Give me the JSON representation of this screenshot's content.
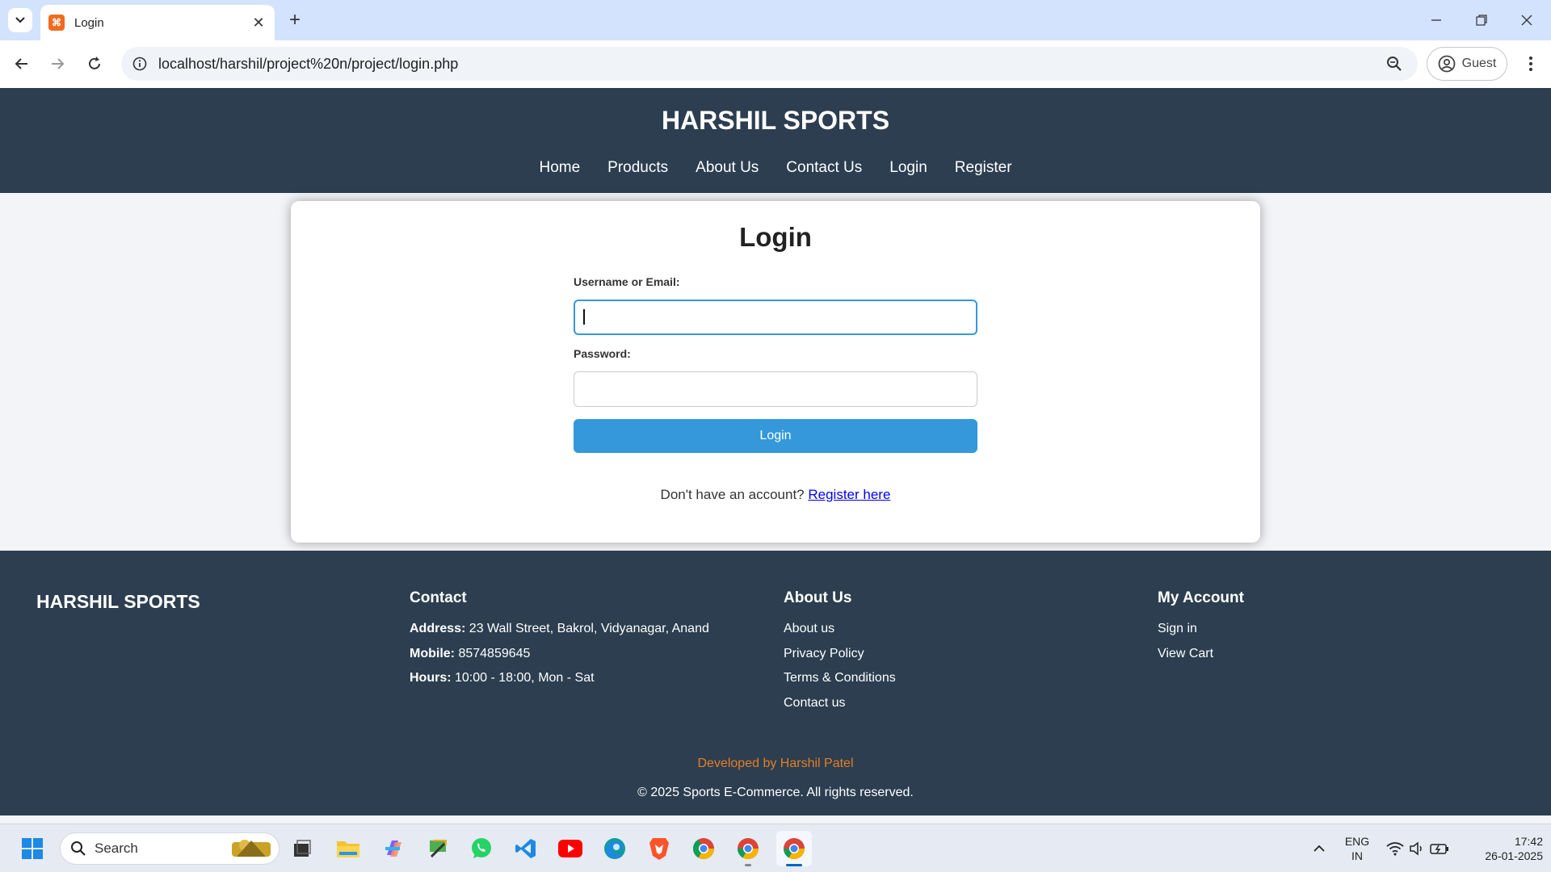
{
  "browser": {
    "tab_title": "Login",
    "favicon_text": "⌘",
    "url": "localhost/harshil/project%20n/project/login.php",
    "profile_label": "Guest"
  },
  "site": {
    "title": "HARSHIL SPORTS",
    "nav": [
      "Home",
      "Products",
      "About Us",
      "Contact Us",
      "Login",
      "Register"
    ]
  },
  "login": {
    "title": "Login",
    "username_label": "Username or Email:",
    "username_value": "",
    "password_label": "Password:",
    "password_value": "",
    "button_label": "Login",
    "no_account_text": "Don't have an account? ",
    "register_link": "Register here"
  },
  "footer": {
    "brand": "HARSHIL SPORTS",
    "contact": {
      "heading": "Contact",
      "address_label": "Address:",
      "address_value": " 23 Wall Street, Bakrol, Vidyanagar, Anand",
      "mobile_label": "Mobile:",
      "mobile_value": " 8574859645",
      "hours_label": "Hours:",
      "hours_value": " 10:00 - 18:00, Mon - Sat"
    },
    "about": {
      "heading": "About Us",
      "links": [
        "About us",
        "Privacy Policy",
        "Terms & Conditions",
        "Contact us"
      ]
    },
    "account": {
      "heading": "My Account",
      "links": [
        "Sign in",
        "View Cart"
      ]
    },
    "developer": "Developed by Harshil Patel",
    "copyright": "© 2025 Sports E-Commerce. All rights reserved."
  },
  "taskbar": {
    "search_placeholder": "Search",
    "lang_line1": "ENG",
    "lang_line2": "IN",
    "time": "17:42",
    "date": "26-01-2025"
  },
  "colors": {
    "header_bg": "#2c3e50",
    "accent": "#3498db",
    "developer_text": "#e67e22"
  }
}
